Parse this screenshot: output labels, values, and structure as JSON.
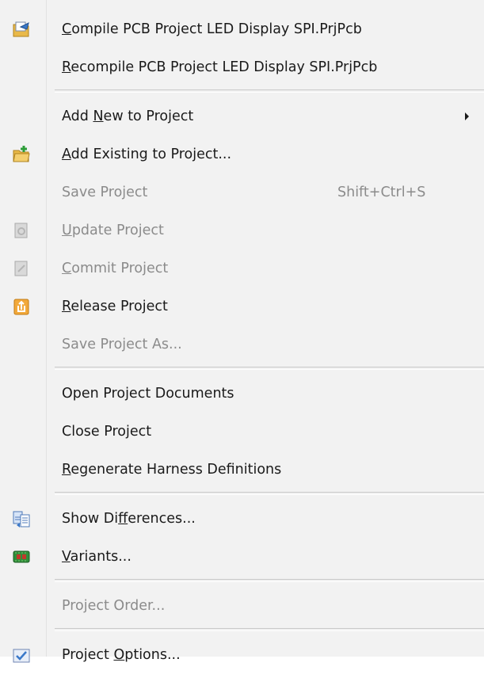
{
  "menu": {
    "items": [
      {
        "type": "item",
        "name": "menu-item-compile-pcb-project",
        "label": "Compile PCB Project LED Display SPI.PrjPcb",
        "mnemonic": 0,
        "icon": "compile-project-icon",
        "enabled": true
      },
      {
        "type": "item",
        "name": "menu-item-recompile-pcb-project",
        "label": "Recompile PCB Project LED Display SPI.PrjPcb",
        "mnemonic": 0,
        "icon": null,
        "enabled": true
      },
      {
        "type": "separator"
      },
      {
        "type": "item",
        "name": "menu-item-add-new-to-project",
        "label": "Add New to Project",
        "mnemonic": 4,
        "icon": null,
        "enabled": true,
        "submenu": true
      },
      {
        "type": "item",
        "name": "menu-item-add-existing-to-project",
        "label": "Add Existing to Project...",
        "mnemonic": 0,
        "icon": "add-existing-folder-icon",
        "enabled": true
      },
      {
        "type": "item",
        "name": "menu-item-save-project",
        "label": "Save Project",
        "mnemonic": -1,
        "icon": null,
        "enabled": false,
        "shortcut": "Shift+Ctrl+S"
      },
      {
        "type": "item",
        "name": "menu-item-update-project",
        "label": "Update Project",
        "mnemonic": 0,
        "icon": "update-project-icon",
        "enabled": false
      },
      {
        "type": "item",
        "name": "menu-item-commit-project",
        "label": "Commit Project",
        "mnemonic": 0,
        "icon": "commit-project-icon",
        "enabled": false
      },
      {
        "type": "item",
        "name": "menu-item-release-project",
        "label": "Release Project",
        "mnemonic": 0,
        "icon": "release-project-icon",
        "enabled": true
      },
      {
        "type": "item",
        "name": "menu-item-save-project-as",
        "label": "Save Project As...",
        "mnemonic": -1,
        "icon": null,
        "enabled": false
      },
      {
        "type": "separator"
      },
      {
        "type": "item",
        "name": "menu-item-open-project-documents",
        "label": "Open Project Documents",
        "mnemonic": -1,
        "icon": null,
        "enabled": true
      },
      {
        "type": "item",
        "name": "menu-item-close-project",
        "label": "Close Project",
        "mnemonic": -1,
        "icon": null,
        "enabled": true
      },
      {
        "type": "item",
        "name": "menu-item-regenerate-harness-definitions",
        "label": "Regenerate Harness Definitions",
        "mnemonic": 0,
        "icon": null,
        "enabled": true
      },
      {
        "type": "separator"
      },
      {
        "type": "item",
        "name": "menu-item-show-differences",
        "label": "Show Differences...",
        "mnemonic": 7,
        "icon": "show-differences-icon",
        "enabled": true
      },
      {
        "type": "item",
        "name": "menu-item-variants",
        "label": "Variants...",
        "mnemonic": 0,
        "icon": "variants-board-icon",
        "enabled": true
      },
      {
        "type": "separator"
      },
      {
        "type": "item",
        "name": "menu-item-project-order",
        "label": "Project Order...",
        "mnemonic": -1,
        "icon": null,
        "enabled": false
      },
      {
        "type": "separator"
      },
      {
        "type": "item",
        "name": "menu-item-project-options",
        "label": "Project Options...",
        "mnemonic": 8,
        "icon": "project-options-icon",
        "enabled": true
      }
    ]
  }
}
